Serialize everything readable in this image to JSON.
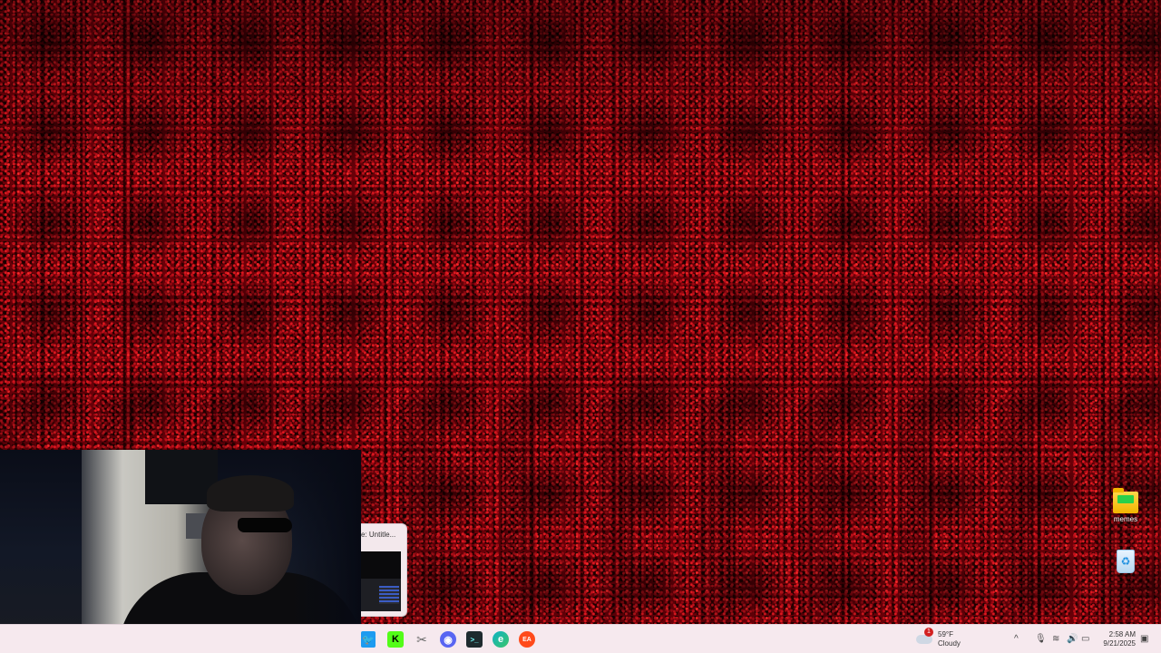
{
  "desktop": {
    "icons": [
      {
        "label": "memes",
        "icon": "folder-icon"
      },
      {
        "label": "",
        "icon": "recycle-bin-icon"
      }
    ]
  },
  "preview": {
    "title": "e: Untitle..."
  },
  "taskbar": {
    "apps": [
      {
        "name": "Twitter",
        "icon": "twitter-icon",
        "glyph": "🐦"
      },
      {
        "name": "Kick",
        "icon": "kick-icon",
        "glyph": "K"
      },
      {
        "name": "Snipping Tool",
        "icon": "snip-icon",
        "glyph": "✂"
      },
      {
        "name": "Discord",
        "icon": "discord-icon",
        "glyph": "◉"
      },
      {
        "name": "Terminal",
        "icon": "terminal-icon",
        "glyph": ">_"
      },
      {
        "name": "Edge",
        "icon": "edge-icon",
        "glyph": "e"
      },
      {
        "name": "EA",
        "icon": "ea-icon",
        "glyph": "EA"
      }
    ],
    "weather": {
      "temperature": "59°F",
      "condition": "Cloudy",
      "alert_count": "1"
    },
    "tray": {
      "chevron": "^",
      "mic": "🎙",
      "wifi": "≋",
      "volume": "🔊",
      "battery": "▭",
      "notifications": "▣"
    },
    "clock": {
      "time": "2:58 AM",
      "date": "9/21/2025"
    }
  },
  "colors": {
    "taskbar_bg": "#f6e9ee",
    "wallpaper_red": "#c0101a"
  }
}
